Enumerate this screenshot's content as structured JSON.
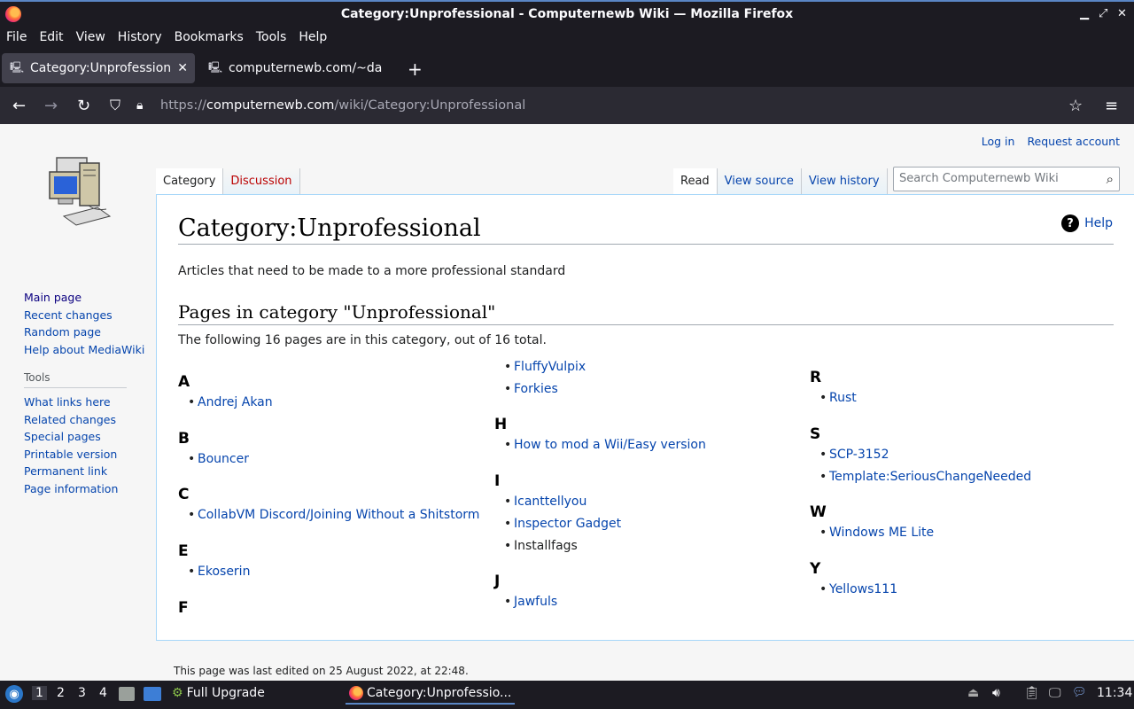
{
  "window": {
    "title": "Category:Unprofessional - Computernewb Wiki — Mozilla Firefox"
  },
  "menu": [
    "File",
    "Edit",
    "View",
    "History",
    "Bookmarks",
    "Tools",
    "Help"
  ],
  "tabs": [
    {
      "label": "Category:Unprofessiona"
    },
    {
      "label": "computernewb.com/~da"
    }
  ],
  "url": {
    "prefix": "https://",
    "host": "computernewb.com",
    "path": "/wiki/Category:Unprofessional"
  },
  "personal": {
    "login": "Log in",
    "request": "Request account"
  },
  "nav": {
    "main": [
      "Main page",
      "Recent changes",
      "Random page",
      "Help about MediaWiki"
    ],
    "tools_heading": "Tools",
    "tools": [
      "What links here",
      "Related changes",
      "Special pages",
      "Printable version",
      "Permanent link",
      "Page information"
    ]
  },
  "page_tabs": {
    "category": "Category",
    "discussion": "Discussion",
    "read": "Read",
    "view_source": "View source",
    "view_history": "View history"
  },
  "search": {
    "placeholder": "Search Computernewb Wiki"
  },
  "content": {
    "title": "Category:Unprofessional",
    "help": "Help",
    "description": "Articles that need to be made to a more professional standard",
    "subheading": "Pages in category \"Unprofessional\"",
    "count_text": "The following 16 pages are in this category, out of 16 total."
  },
  "groups": {
    "A": {
      "letter": "A",
      "items": [
        "Andrej Akan"
      ]
    },
    "B": {
      "letter": "B",
      "items": [
        "Bouncer"
      ]
    },
    "C": {
      "letter": "C",
      "items": [
        "CollabVM Discord/Joining Without a Shitstorm"
      ]
    },
    "E": {
      "letter": "E",
      "items": [
        "Ekoserin"
      ]
    },
    "F": {
      "letter": "F",
      "items": [
        "FluffyVulpix",
        "Forkies"
      ]
    },
    "H": {
      "letter": "H",
      "items": [
        "How to mod a Wii/Easy version"
      ]
    },
    "I": {
      "letter": "I",
      "items": [
        "Icanttellyou",
        "Inspector Gadget",
        "Installfags"
      ]
    },
    "J": {
      "letter": "J",
      "items": [
        "Jawfuls"
      ]
    },
    "R": {
      "letter": "R",
      "items": [
        "Rust"
      ]
    },
    "S": {
      "letter": "S",
      "items": [
        "SCP-3152",
        "Template:SeriousChangeNeeded"
      ]
    },
    "W": {
      "letter": "W",
      "items": [
        "Windows ME Lite"
      ]
    },
    "Y": {
      "letter": "Y",
      "items": [
        "Yellows111"
      ]
    }
  },
  "footer": "This page was last edited on 25 August 2022, at 22:48.",
  "taskbar": {
    "workspaces": [
      "1",
      "2",
      "3",
      "4"
    ],
    "tasks": [
      "Full Upgrade",
      "Category:Unprofessio..."
    ],
    "clock": "11:34"
  }
}
